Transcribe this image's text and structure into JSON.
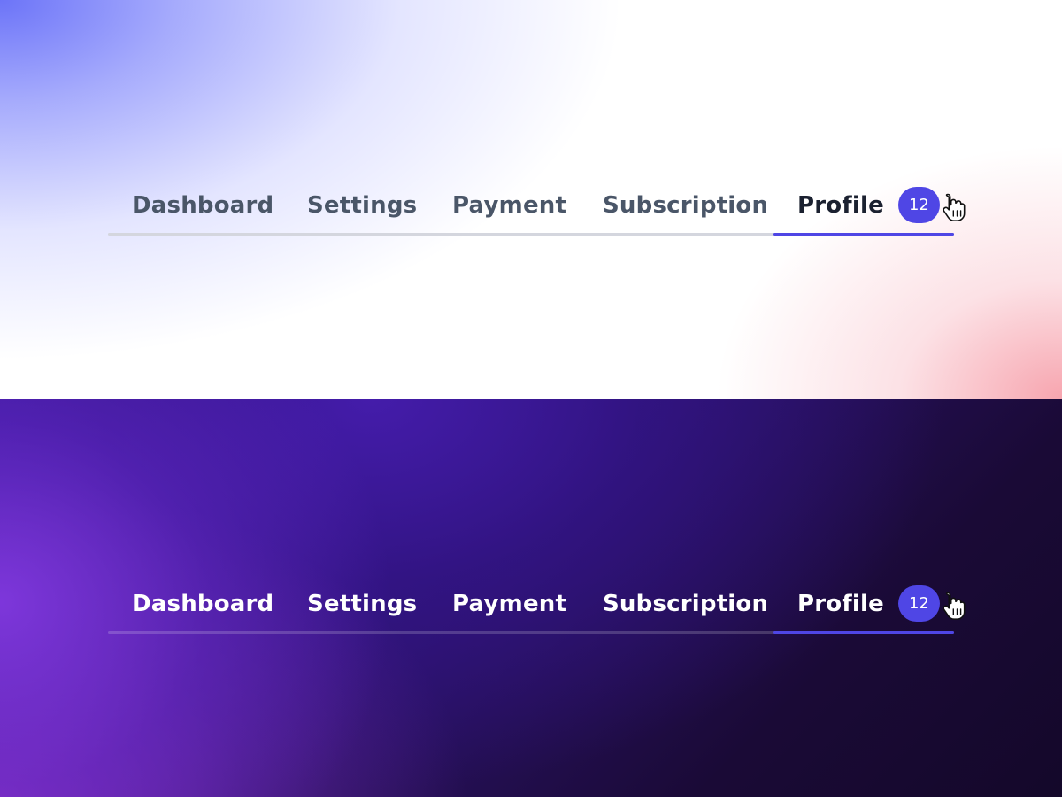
{
  "colors": {
    "accent": "#4f46e5",
    "badge_bg": "#4f46e5",
    "light_text": "#4a5668",
    "light_active_text": "#1b2130",
    "dark_text": "#ffffff"
  },
  "light": {
    "tabs": [
      {
        "label": "Dashboard"
      },
      {
        "label": "Settings"
      },
      {
        "label": "Payment"
      },
      {
        "label": "Subscription"
      },
      {
        "label": "Profile",
        "badge": "12"
      }
    ],
    "active_tab": "Profile",
    "cursor_icon": "hand-pointer-icon"
  },
  "dark": {
    "tabs": [
      {
        "label": "Dashboard"
      },
      {
        "label": "Settings"
      },
      {
        "label": "Payment"
      },
      {
        "label": "Subscription"
      },
      {
        "label": "Profile",
        "badge": "12"
      }
    ],
    "active_tab": "Profile",
    "cursor_icon": "hand-pointer-icon"
  }
}
